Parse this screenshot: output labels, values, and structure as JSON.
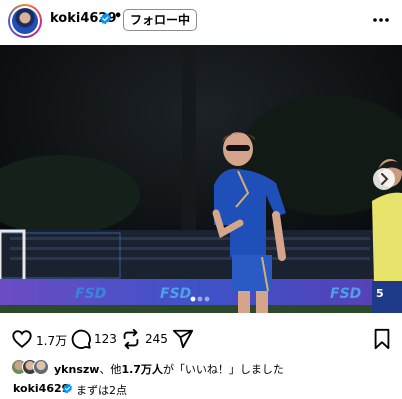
{
  "post": {
    "username": "koki4629",
    "separator": "•",
    "follow_label": "フォロー中",
    "likes_count": "1.7万",
    "comments_count": "123",
    "reposts_count": "245",
    "liked_by_user": "yknszw",
    "liked_by_mid": "、他",
    "liked_by_others": "1.7万人",
    "liked_by_suffix": "が「いいね！」しました",
    "caption_user": "koki4629",
    "caption_text": "まずは2点",
    "carousel": {
      "total": 3,
      "current": 1
    }
  },
  "photo": {
    "banner_texts": [
      "FSD",
      "FSD",
      "FSD"
    ],
    "jersey_number": "5"
  },
  "icons": {
    "avatar": "profile-avatar",
    "verified": "verified-badge-icon",
    "more": "more-options-icon",
    "like": "heart-icon",
    "comment": "comment-icon",
    "repost": "repost-icon",
    "share": "send-icon",
    "save": "bookmark-icon",
    "next": "chevron-right-icon"
  },
  "colors": {
    "verified_blue": "#0095f6",
    "text": "#000000",
    "jersey_blue": "#1f4fb8"
  }
}
